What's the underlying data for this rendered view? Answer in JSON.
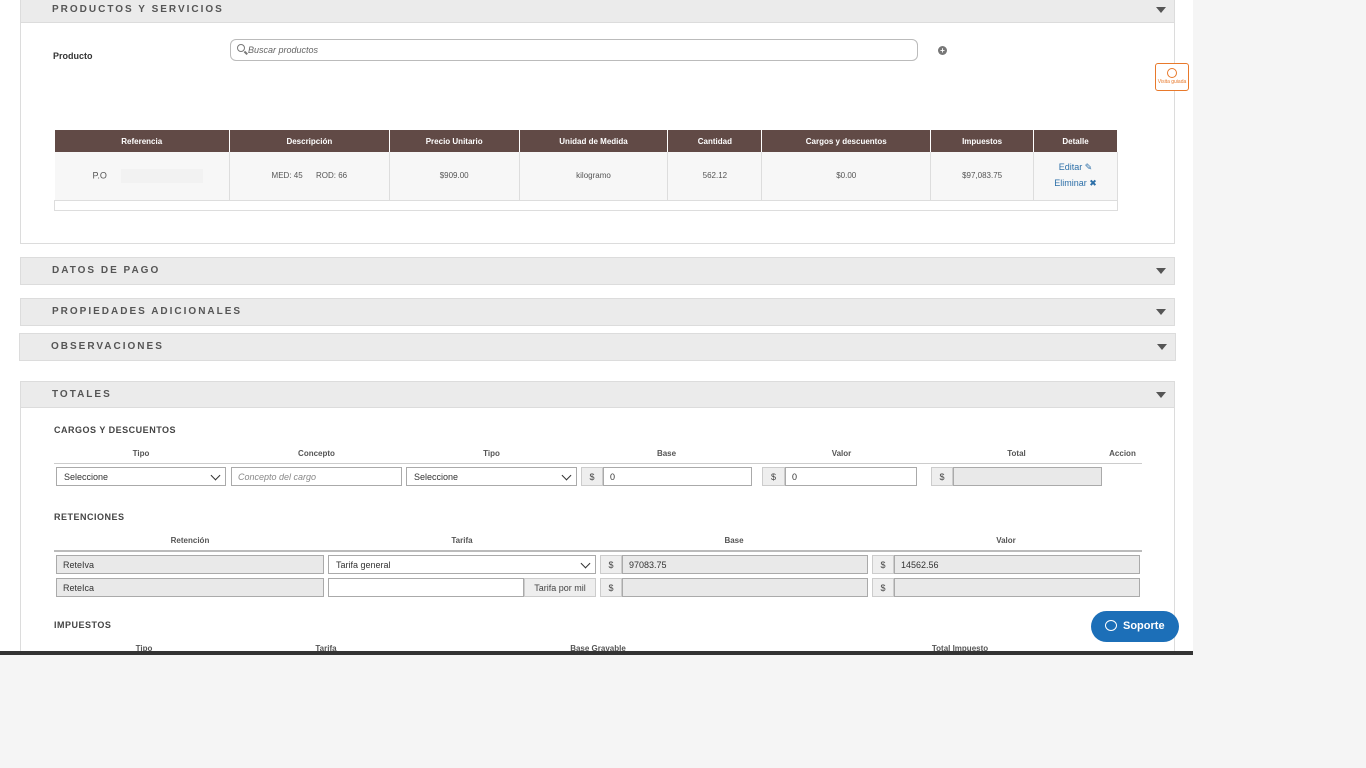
{
  "productos": {
    "title": "PRODUCTOS Y SERVICIOS",
    "producto_label": "Producto",
    "search_placeholder": "Buscar productos",
    "columns": [
      "Referencia",
      "Descripción",
      "Precio Unitario",
      "Unidad de Medida",
      "Cantidad",
      "Cargos y descuentos",
      "Impuestos",
      "Detalle"
    ],
    "rows": [
      {
        "referencia": "P.O",
        "desc_med": "MED: 45",
        "desc_rod": "ROD: 66",
        "precio": "$909.00",
        "unidad": "kilogramo",
        "cantidad": "562.12",
        "cargos": "$0.00",
        "impuestos": "$97,083.75",
        "editar": "Editar",
        "eliminar": "Eliminar"
      }
    ]
  },
  "guide": {
    "label": "Visita guiada"
  },
  "datos_pago": {
    "title": "DATOS DE PAGO"
  },
  "propiedades": {
    "title": "PROPIEDADES ADICIONALES"
  },
  "observaciones": {
    "title": "OBSERVACIONES"
  },
  "totales": {
    "title": "TOTALES",
    "cargos": {
      "title": "CARGOS Y DESCUENTOS",
      "columns": [
        "Tipo",
        "Concepto",
        "Tipo",
        "Base",
        "Valor",
        "Total",
        "Accion"
      ],
      "tipo_value": "Seleccione",
      "concepto_placeholder": "Concepto del cargo",
      "tipo2_value": "Seleccione",
      "currency": "$",
      "base_value": "0",
      "valor_value": "0",
      "total_value": ""
    },
    "retenciones": {
      "title": "RETENCIONES",
      "columns": [
        "Retención",
        "Tarifa",
        "Base",
        "Valor"
      ],
      "currency": "$",
      "rows": [
        {
          "name": "ReteIva",
          "tarifa": "Tarifa general",
          "base": "97083.75",
          "valor": "14562.56"
        },
        {
          "name": "ReteIca",
          "tarifa_unit": "Tarifa por mil",
          "base": "",
          "valor": ""
        }
      ]
    },
    "impuestos": {
      "title": "IMPUESTOS",
      "columns": [
        "Tipo",
        "Tarifa",
        "Base Gravable",
        "Total Impuesto"
      ]
    }
  },
  "soporte": {
    "label": "Soporte"
  },
  "colors": {
    "header_brown": "#614a46",
    "support_blue": "#1c6fb8",
    "guide_orange": "#e8792b"
  }
}
